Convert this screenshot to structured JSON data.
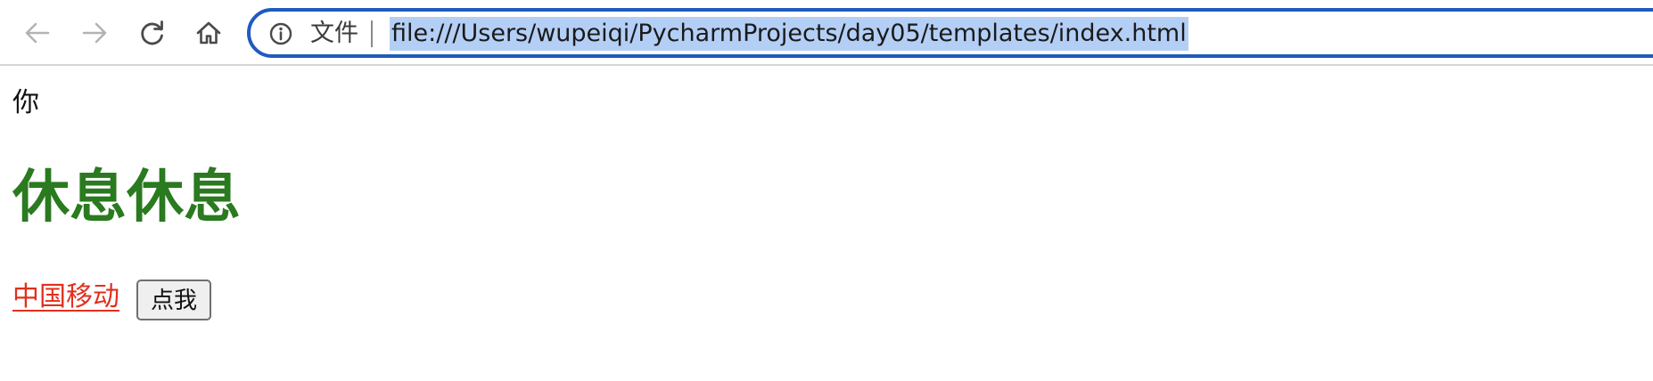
{
  "browser": {
    "file_label": "文件",
    "url": "file:///Users/wupeiqi/PycharmProjects/day05/templates/index.html",
    "icons": {
      "back": "arrow-left-icon",
      "forward": "arrow-right-icon",
      "reload": "reload-icon",
      "home": "home-icon",
      "info": "info-icon"
    },
    "colors": {
      "focus_ring": "#1f5bbf",
      "url_selection": "#b4cff5"
    }
  },
  "page": {
    "text": "你",
    "heading": "休息休息",
    "link_text": "中国移动",
    "button_label": "点我",
    "colors": {
      "heading": "#2a7a1f",
      "link": "#e0301e"
    }
  }
}
